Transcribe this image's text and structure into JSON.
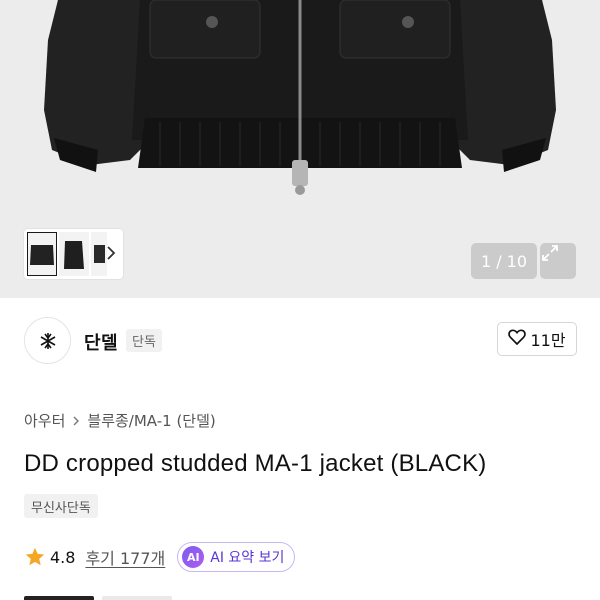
{
  "gallery": {
    "counter": "1 / 10",
    "thumbnails": [
      "jacket-front",
      "jacket-side",
      "jacket-back"
    ],
    "icons": {
      "next": "chevron-right-icon",
      "expand": "expand-icon"
    }
  },
  "brand": {
    "name": "단델",
    "badge": "단독",
    "logo": "brand-logo",
    "likes": "11만"
  },
  "product": {
    "breadcrumb": [
      "아우터",
      "블루종/MA-1 (단델)"
    ],
    "title": "DD cropped studded MA-1 jacket (BLACK)",
    "exclusive_tag": "무신사단독",
    "rating": "4.8",
    "reviews": "후기 177개",
    "ai_badge": "AI",
    "ai_summary": "AI 요약 보기"
  },
  "colors": {
    "star": "#f5a623",
    "ai_accent": "#7b5cf0",
    "hero_bg": "#ececec"
  }
}
